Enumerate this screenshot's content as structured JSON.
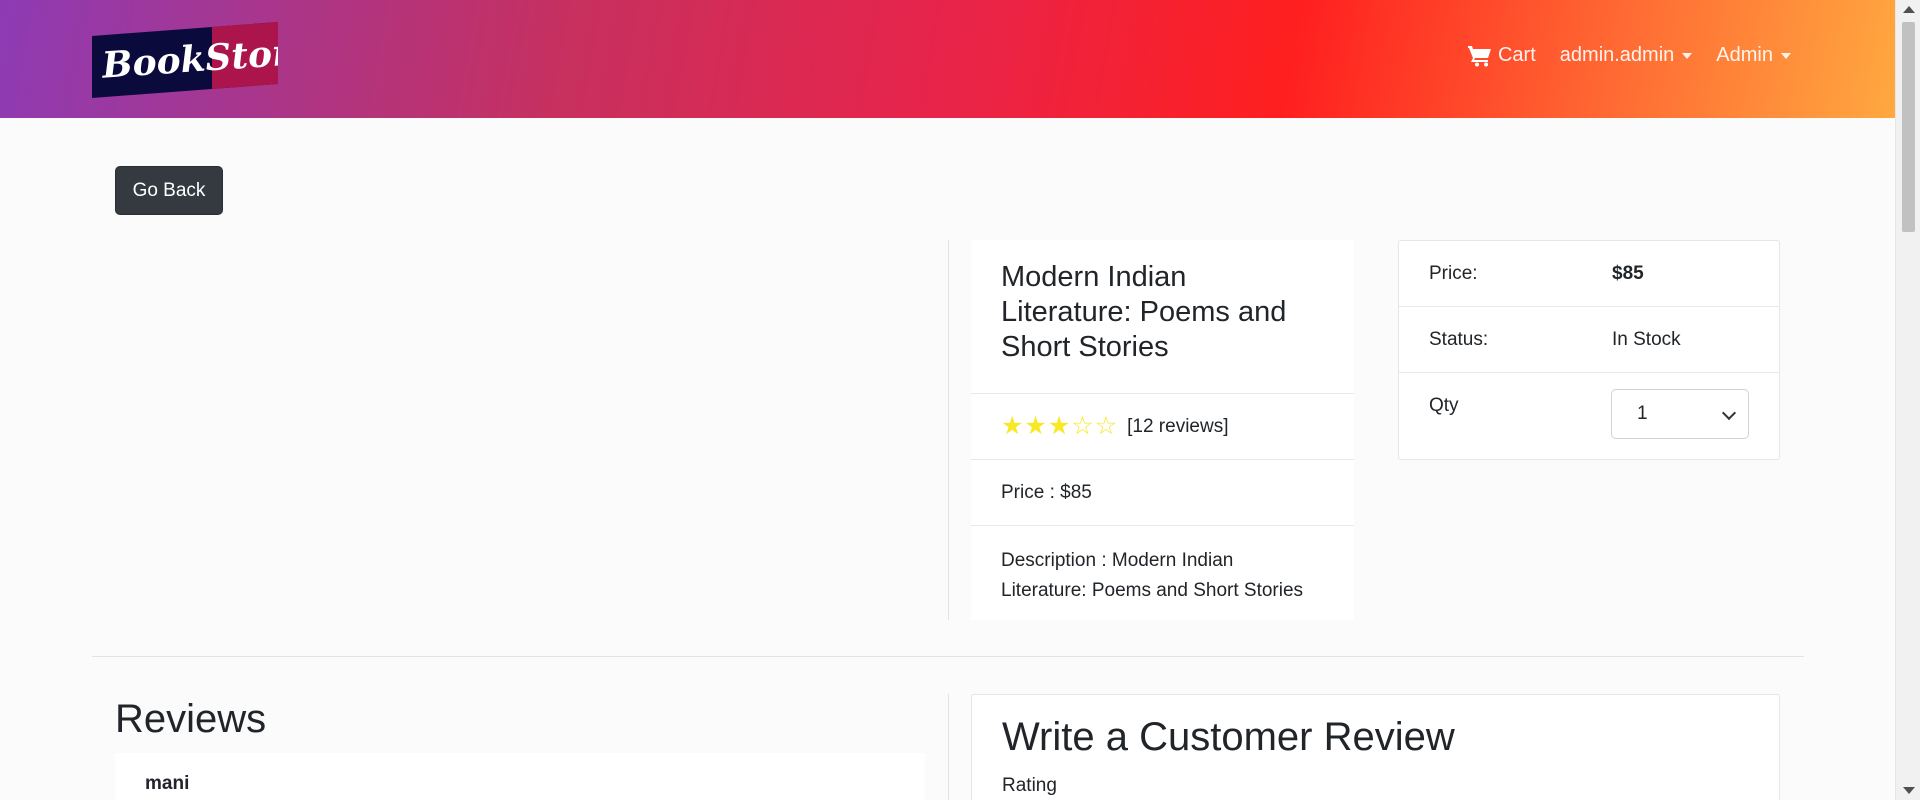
{
  "navbar": {
    "logo_text": "BookStore",
    "cart_label": "Cart",
    "user_label": "admin.admin",
    "admin_label": "Admin"
  },
  "back_button": "Go Back",
  "product": {
    "title": "Modern Indian Literature: Poems and Short Stories",
    "rating": 2.5,
    "rating_max": 5,
    "reviews_text": "[12 reviews]",
    "price_text": "Price : $85",
    "description_text": "Description : Modern Indian Literature: Poems and Short Stories"
  },
  "purchase": {
    "price_label": "Price:",
    "price_value": "$85",
    "status_label": "Status:",
    "status_value": "In Stock",
    "qty_label": "Qty",
    "qty_value": "1"
  },
  "reviews": {
    "heading": "Reviews",
    "items": [
      {
        "name": "mani"
      }
    ]
  },
  "write_review": {
    "heading": "Write a Customer Review",
    "rating_label": "Rating"
  },
  "colors": {
    "star": "#f8e825",
    "button": "#343a40"
  },
  "icons": {
    "cart": "shopping-cart-icon",
    "star": "star-icon"
  }
}
